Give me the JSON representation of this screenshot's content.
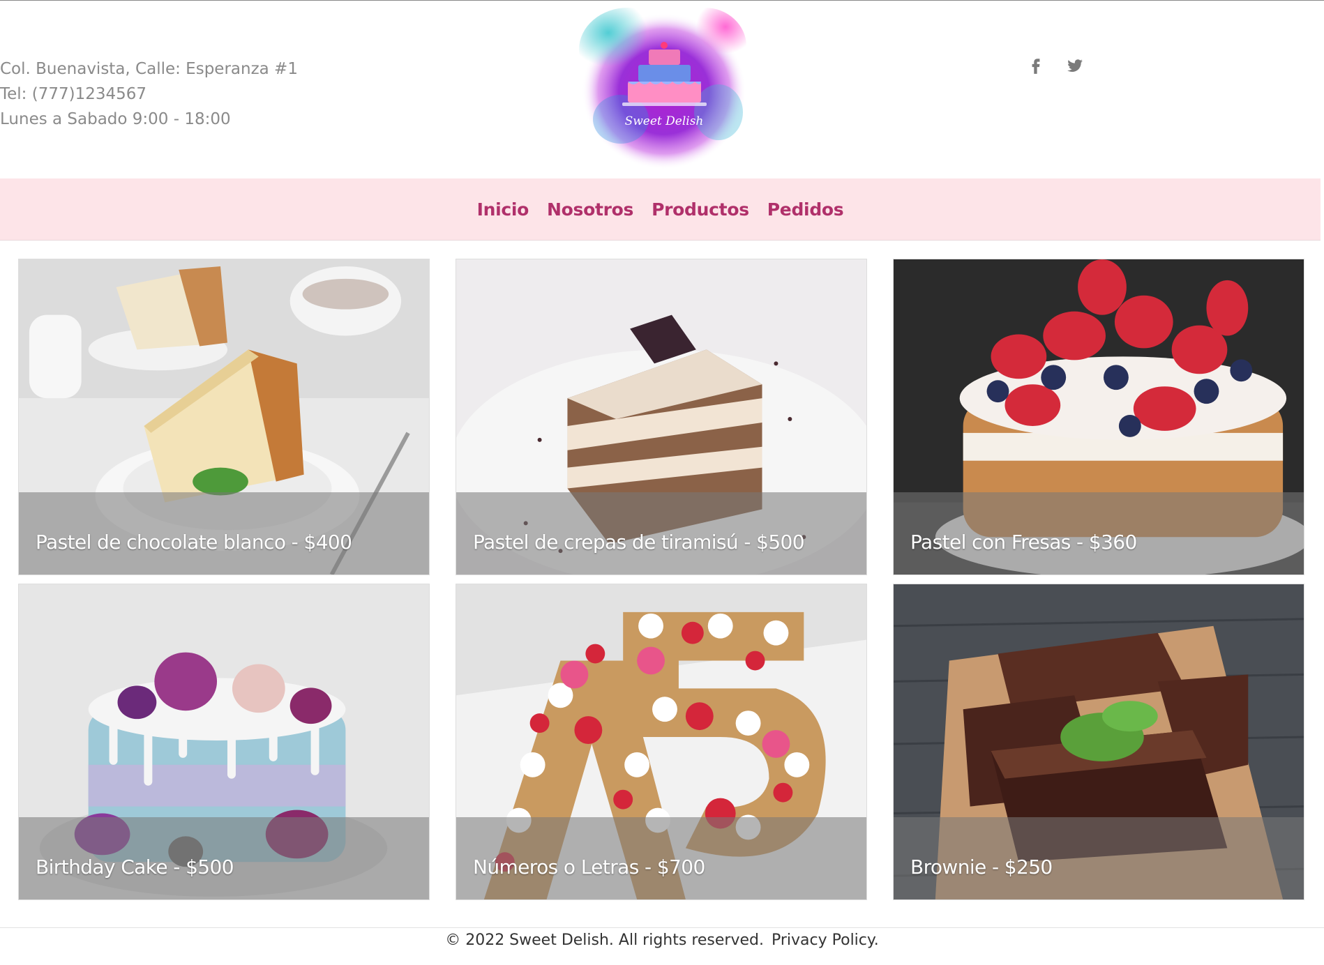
{
  "header": {
    "address": "Col. Buenavista, Calle: Esperanza #1",
    "phone": "Tel: (777)1234567",
    "hours": "Lunes a Sabado 9:00 - 18:00",
    "logo_text": "Sweet Delish",
    "social": [
      "facebook-icon",
      "twitter-icon"
    ]
  },
  "nav": {
    "items": [
      {
        "label": "Inicio"
      },
      {
        "label": "Nosotros"
      },
      {
        "label": "Productos"
      },
      {
        "label": "Pedidos"
      }
    ]
  },
  "products": [
    {
      "caption": "Pastel de chocolate blanco - $400"
    },
    {
      "caption": "Pastel de crepas de tiramisú - $500"
    },
    {
      "caption": "Pastel con Fresas - $360"
    },
    {
      "caption": "Birthday Cake - $500"
    },
    {
      "caption": "Números o Letras - $700"
    },
    {
      "caption": "Brownie - $250"
    }
  ],
  "footer": {
    "copyright": "©  2022 Sweet Delish.  All rights reserved.",
    "privacy": "Privacy Policy."
  },
  "colors": {
    "nav_bg": "#fde4e8",
    "nav_text": "#b0306a",
    "contact_text": "#8a8a8a"
  }
}
